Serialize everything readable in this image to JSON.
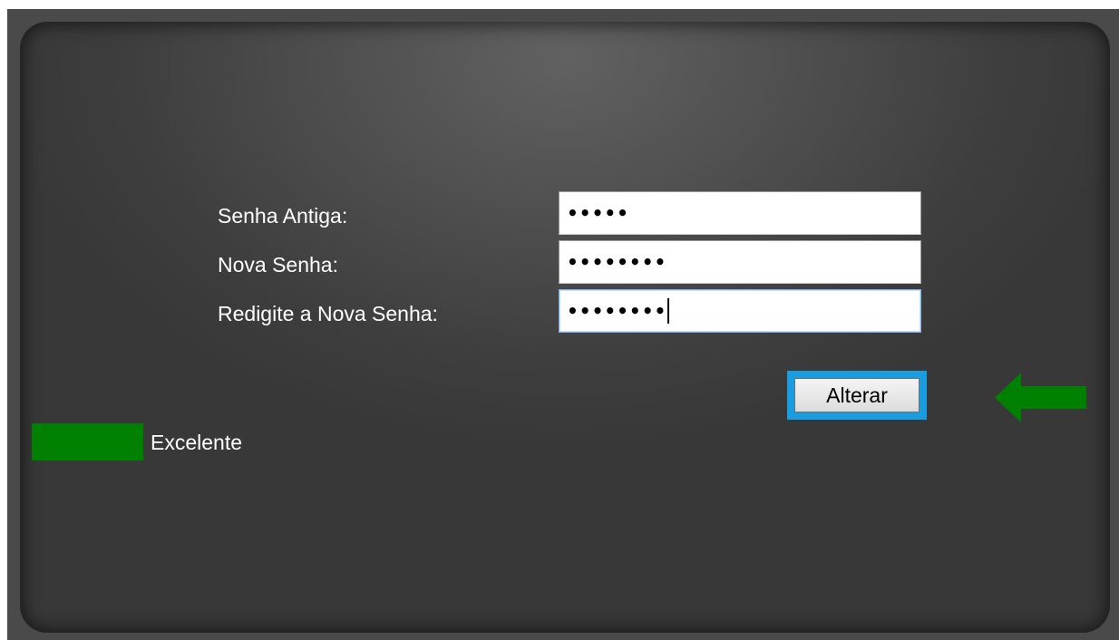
{
  "form": {
    "old_password_label": "Senha Antiga:",
    "old_password_value": "•••••",
    "new_password_label": "Nova Senha:",
    "new_password_value": "••••••••",
    "confirm_password_label": "Redigite a Nova Senha:",
    "confirm_password_value": "••••••••",
    "submit_label": "Alterar"
  },
  "strength": {
    "label": "Excelente",
    "color": "#008000"
  },
  "arrow": {
    "icon": "left-arrow-icon",
    "color": "#008000"
  },
  "colors": {
    "button_focus_border": "#1a9ce0",
    "panel_background": "#4a4a4a"
  }
}
